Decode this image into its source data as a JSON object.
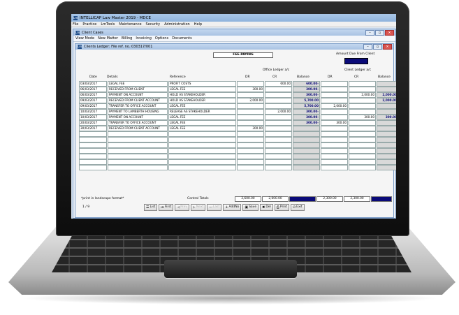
{
  "app": {
    "title": "INTELLICAP Law Master 2019 - MDCE",
    "menus": [
      "File",
      "Practice",
      "LmTools",
      "Maintenance",
      "Security",
      "Administration",
      "Help"
    ]
  },
  "child": {
    "title": "Client Cases",
    "tabs": [
      "View Mode",
      "New Matter",
      "Billing",
      "Invoicing",
      "Options",
      "Documents"
    ]
  },
  "ledger": {
    "title": "Clients Ledger: File ref. no.:030317/001",
    "fee_status": "FEE-PAYING",
    "amount_due_label": "Amount Due From Client",
    "office_group": "Office Ledger a/c",
    "client_group": "Client Ledger a/c",
    "columns": {
      "date": "Date",
      "details": "Details",
      "reference": "Reference",
      "dr": "DR",
      "cr": "CR",
      "balance": "Balance"
    },
    "rows": [
      {
        "date": "03/03/2017",
        "details": "LEGAL FEE",
        "reference": "PROFIT COSTS",
        "odr": "",
        "ocr": "600.00",
        "obal": "600.00-",
        "cdr": "",
        "ccr": "",
        "cbal": ""
      },
      {
        "date": "06/03/2017",
        "details": "RECEIVED FROM CLIENT",
        "reference": "LEGAL FEE",
        "odr": "300.00",
        "ocr": "",
        "obal": "300.00-",
        "cdr": "",
        "ccr": "",
        "cbal": ""
      },
      {
        "date": "06/03/2017",
        "details": "PAYMENT ON ACCOUNT",
        "reference": "HOLD AS STAKEHOLDER",
        "odr": "",
        "ocr": "",
        "obal": "300.00-",
        "cdr": "",
        "ccr": "2,000.00",
        "cbal": "2,000.00"
      },
      {
        "date": "09/03/2017",
        "details": "RECEIVED FROM CLIENT ACCOUNT",
        "reference": "HOLD AS STAKEHOLDER",
        "odr": "2,000.00",
        "ocr": "",
        "obal": "5,700.00",
        "cdr": "",
        "ccr": "",
        "cbal": "2,000.00"
      },
      {
        "date": "09/03/2017",
        "details": "TRANSFER TO OFFICE ACCOUNT",
        "reference": "LEGAL FEE",
        "odr": "",
        "ocr": "",
        "obal": "5,700.00",
        "cdr": "2,000.00",
        "ccr": "",
        "cbal": ""
      },
      {
        "date": "10/03/2017",
        "details": "PAYMENT TO LAMBERTH HOUSING",
        "reference": "RELEASE AS STAKEHOLDER",
        "odr": "",
        "ocr": "2,000.00",
        "obal": "300.00-",
        "cdr": "",
        "ccr": "",
        "cbal": ""
      },
      {
        "date": "10/03/2017",
        "details": "PAYMENT ON ACCOUNT",
        "reference": "LEGAL FEE",
        "odr": "",
        "ocr": "",
        "obal": "300.00-",
        "cdr": "",
        "ccr": "300.00",
        "cbal": "300.00"
      },
      {
        "date": "20/03/2017",
        "details": "TRANSFER TO OFFICE ACCOUNT",
        "reference": "LEGAL FEE",
        "odr": "",
        "ocr": "",
        "obal": "300.00-",
        "cdr": "300.00",
        "ccr": "",
        "cbal": ""
      },
      {
        "date": "30/03/2017",
        "details": "RECEIVED FROM CLIENT ACCOUNT",
        "reference": "LEGAL FEE",
        "odr": "300.00",
        "ocr": "",
        "obal": "",
        "cdr": "",
        "ccr": "",
        "cbal": ""
      }
    ],
    "note": "*print in landscape format*",
    "control_totals_label": "Control Totals",
    "totals": {
      "odr": "2,600.00",
      "ocr": "2,600.00",
      "cdr": "2,300.00",
      "ccr": "2,300.00"
    },
    "pager": "1  /  9",
    "buttons": [
      {
        "label": "List",
        "icon": "list-icon",
        "enabled": true
      },
      {
        "label": "First",
        "icon": "first-icon",
        "enabled": true
      },
      {
        "label": "Prev",
        "icon": "prev-icon",
        "enabled": false
      },
      {
        "label": "Next",
        "icon": "next-icon",
        "enabled": false
      },
      {
        "label": "Last",
        "icon": "last-icon",
        "enabled": false
      },
      {
        "label": "AddNo",
        "icon": "add-icon",
        "enabled": true
      },
      {
        "label": "Save",
        "icon": "save-icon",
        "enabled": true
      },
      {
        "label": "Del",
        "icon": "delete-icon",
        "enabled": true
      },
      {
        "label": "Print",
        "icon": "print-icon",
        "enabled": true
      },
      {
        "label": "Exit",
        "icon": "exit-icon",
        "enabled": true
      }
    ]
  }
}
